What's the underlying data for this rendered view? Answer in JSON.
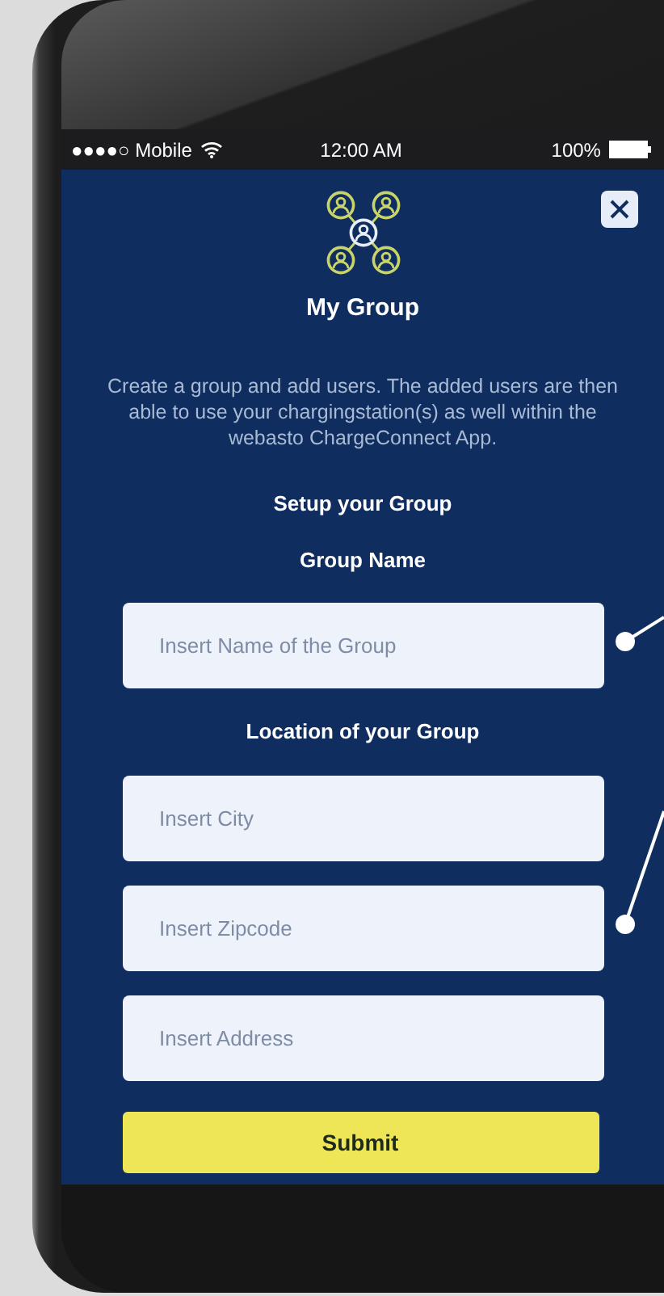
{
  "status_bar": {
    "carrier": "●●●●○ Mobile",
    "time": "12:00 AM",
    "battery": "100%"
  },
  "title": "My Group",
  "description": "Create a group and add users. The added users are then able to use your chargingstation(s) as well within the webasto ChargeConnect App.",
  "form_title": "Setup your Group",
  "groups": [
    {
      "label": "Group Name",
      "fields": [
        {
          "placeholder": "Insert Name of the Group"
        }
      ]
    },
    {
      "label": "Location of your Group",
      "fields": [
        {
          "placeholder": "Insert City"
        },
        {
          "placeholder": "Insert Zipcode"
        },
        {
          "placeholder": "Insert Address"
        }
      ]
    }
  ],
  "submit": "Submit"
}
